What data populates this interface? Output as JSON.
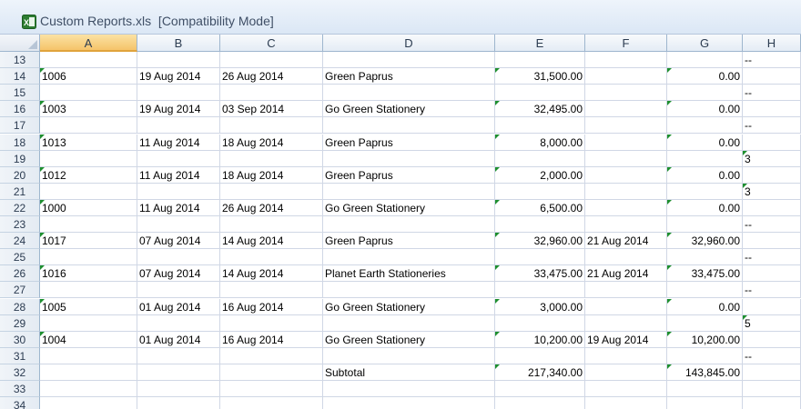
{
  "window": {
    "title": "Custom Reports.xls  [Compatibility Mode]",
    "icon": "excel-icon"
  },
  "columns": [
    "A",
    "B",
    "C",
    "D",
    "E",
    "F",
    "G",
    "H"
  ],
  "selected_column": "A",
  "rows": [
    {
      "num": "13",
      "cells": {
        "H": "--"
      },
      "flags": []
    },
    {
      "num": "14",
      "cells": {
        "A": "1006",
        "B": "19 Aug 2014",
        "C": "26 Aug 2014",
        "D": "Green Paprus",
        "E": "31,500.00",
        "G": "0.00"
      },
      "flags": [
        "A",
        "E",
        "G"
      ]
    },
    {
      "num": "15",
      "cells": {
        "H": "--"
      },
      "flags": []
    },
    {
      "num": "16",
      "cells": {
        "A": "1003",
        "B": "19 Aug 2014",
        "C": "03 Sep 2014",
        "D": "Go Green Stationery",
        "E": "32,495.00",
        "G": "0.00"
      },
      "flags": [
        "A",
        "E",
        "G"
      ]
    },
    {
      "num": "17",
      "cells": {
        "H": "--"
      },
      "flags": []
    },
    {
      "num": "18",
      "cells": {
        "A": "1013",
        "B": "11 Aug 2014",
        "C": "18 Aug 2014",
        "D": "Green Paprus",
        "E": "8,000.00",
        "G": "0.00"
      },
      "flags": [
        "A",
        "E",
        "G"
      ]
    },
    {
      "num": "19",
      "cells": {
        "H": "3"
      },
      "flags": [
        "H"
      ]
    },
    {
      "num": "20",
      "cells": {
        "A": "1012",
        "B": "11 Aug 2014",
        "C": "18 Aug 2014",
        "D": "Green Paprus",
        "E": "2,000.00",
        "G": "0.00"
      },
      "flags": [
        "A",
        "E",
        "G"
      ]
    },
    {
      "num": "21",
      "cells": {
        "H": "3"
      },
      "flags": [
        "H"
      ]
    },
    {
      "num": "22",
      "cells": {
        "A": "1000",
        "B": "11 Aug 2014",
        "C": "26 Aug 2014",
        "D": "Go Green Stationery",
        "E": "6,500.00",
        "G": "0.00"
      },
      "flags": [
        "A",
        "E",
        "G"
      ]
    },
    {
      "num": "23",
      "cells": {
        "H": "--"
      },
      "flags": []
    },
    {
      "num": "24",
      "cells": {
        "A": "1017",
        "B": "07 Aug 2014",
        "C": "14 Aug 2014",
        "D": "Green Paprus",
        "E": "32,960.00",
        "F": "21 Aug 2014",
        "G": "32,960.00"
      },
      "flags": [
        "A",
        "E",
        "G"
      ]
    },
    {
      "num": "25",
      "cells": {
        "H": "--"
      },
      "flags": []
    },
    {
      "num": "26",
      "cells": {
        "A": "1016",
        "B": "07 Aug 2014",
        "C": "14 Aug 2014",
        "D": "Planet Earth Stationeries",
        "E": "33,475.00",
        "F": "21 Aug 2014",
        "G": "33,475.00"
      },
      "flags": [
        "A",
        "E",
        "G"
      ]
    },
    {
      "num": "27",
      "cells": {
        "H": "--"
      },
      "flags": []
    },
    {
      "num": "28",
      "cells": {
        "A": "1005",
        "B": "01 Aug 2014",
        "C": "16 Aug 2014",
        "D": "Go Green Stationery",
        "E": "3,000.00",
        "G": "0.00"
      },
      "flags": [
        "A",
        "E",
        "G"
      ]
    },
    {
      "num": "29",
      "cells": {
        "H": "5"
      },
      "flags": [
        "H"
      ]
    },
    {
      "num": "30",
      "cells": {
        "A": "1004",
        "B": "01 Aug 2014",
        "C": "16 Aug 2014",
        "D": "Go Green Stationery",
        "E": "10,200.00",
        "F": "19 Aug 2014",
        "G": "10,200.00"
      },
      "flags": [
        "A",
        "E",
        "G"
      ]
    },
    {
      "num": "31",
      "cells": {
        "H": "--"
      },
      "flags": []
    },
    {
      "num": "32",
      "cells": {
        "D": "Subtotal",
        "E": "217,340.00",
        "G": "143,845.00"
      },
      "flags": [
        "E",
        "G"
      ]
    },
    {
      "num": "33",
      "cells": {},
      "flags": []
    },
    {
      "num": "34",
      "cells": {},
      "flags": []
    }
  ],
  "colors": {
    "error_flag": "#1e8f2f",
    "selected_header": "#f5c46a",
    "gridline": "#d0d7e5"
  }
}
